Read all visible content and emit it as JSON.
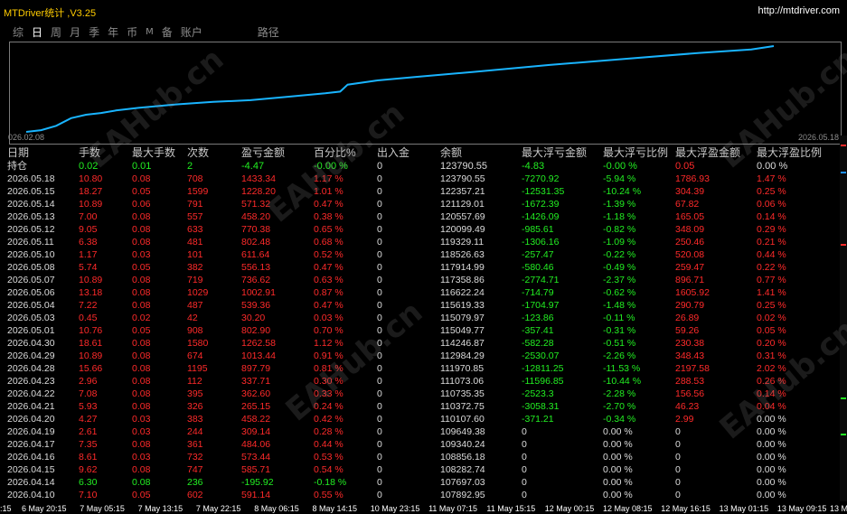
{
  "window": {
    "title": "MTDriver统计 ,V3.25",
    "url": "http://mtdriver.com"
  },
  "tabs": [
    {
      "label": "综",
      "active": false
    },
    {
      "label": "日",
      "active": true
    },
    {
      "label": "周",
      "active": false
    },
    {
      "label": "月",
      "active": false
    },
    {
      "label": "季",
      "active": false
    },
    {
      "label": "年",
      "active": false
    },
    {
      "label": "币",
      "active": false
    },
    {
      "label": "M",
      "active": false
    },
    {
      "label": "备",
      "active": false
    },
    {
      "label": "账户",
      "active": false
    },
    {
      "label": "路径",
      "active": false
    }
  ],
  "equity_chart": {
    "start_label": "026.02.08",
    "end_label": "2026.05.18",
    "line_color": "#19b4ff",
    "points": [
      [
        0,
        0.0
      ],
      [
        0.02,
        0.02
      ],
      [
        0.04,
        0.07
      ],
      [
        0.06,
        0.16
      ],
      [
        0.08,
        0.2
      ],
      [
        0.1,
        0.22
      ],
      [
        0.12,
        0.25
      ],
      [
        0.15,
        0.28
      ],
      [
        0.2,
        0.32
      ],
      [
        0.25,
        0.35
      ],
      [
        0.3,
        0.37
      ],
      [
        0.35,
        0.41
      ],
      [
        0.4,
        0.45
      ],
      [
        0.42,
        0.47
      ],
      [
        0.43,
        0.55
      ],
      [
        0.47,
        0.6
      ],
      [
        0.52,
        0.64
      ],
      [
        0.6,
        0.7
      ],
      [
        0.7,
        0.78
      ],
      [
        0.8,
        0.85
      ],
      [
        0.9,
        0.92
      ],
      [
        0.97,
        0.96
      ],
      [
        1.0,
        1.0
      ]
    ]
  },
  "columns": [
    "日期",
    "手数",
    "最大手数",
    "次数",
    "盈亏金额",
    "百分比%",
    "出入金",
    "余额",
    "最大浮亏金额",
    "最大浮亏比例",
    "最大浮盈金额",
    "最大浮盈比例"
  ],
  "holding": {
    "label": "持仓",
    "lots": "0.02",
    "max_lots": "0.01",
    "count": "2",
    "pnl": "-4.47",
    "pct": "-0.00 %",
    "deposit": "0",
    "balance": "123790.55",
    "max_float_loss": "-4.83",
    "max_float_loss_pct": "-0.00 %",
    "max_float_profit": "0.05",
    "max_float_profit_pct": "0.00 %"
  },
  "rows": [
    {
      "date": "2026.05.18",
      "lots": "10.80",
      "max_lots": "0.08",
      "count": "708",
      "pnl": "1433.34",
      "pct": "1.17 %",
      "deposit": "0",
      "balance": "123790.55",
      "mfl": "-7270.92",
      "mflp": "-5.94 %",
      "mfp": "1786.93",
      "mfpp": "1.47 %",
      "tone": "red"
    },
    {
      "date": "2026.05.15",
      "lots": "18.27",
      "max_lots": "0.05",
      "count": "1599",
      "pnl": "1228.20",
      "pct": "1.01 %",
      "deposit": "0",
      "balance": "122357.21",
      "mfl": "-12531.35",
      "mflp": "-10.24 %",
      "mfp": "304.39",
      "mfpp": "0.25 %",
      "tone": "red"
    },
    {
      "date": "2026.05.14",
      "lots": "10.89",
      "max_lots": "0.06",
      "count": "791",
      "pnl": "571.32",
      "pct": "0.47 %",
      "deposit": "0",
      "balance": "121129.01",
      "mfl": "-1672.39",
      "mflp": "-1.39 %",
      "mfp": "67.82",
      "mfpp": "0.06 %",
      "tone": "red"
    },
    {
      "date": "2026.05.13",
      "lots": "7.00",
      "max_lots": "0.08",
      "count": "557",
      "pnl": "458.20",
      "pct": "0.38 %",
      "deposit": "0",
      "balance": "120557.69",
      "mfl": "-1426.09",
      "mflp": "-1.18 %",
      "mfp": "165.05",
      "mfpp": "0.14 %",
      "tone": "red"
    },
    {
      "date": "2026.05.12",
      "lots": "9.05",
      "max_lots": "0.08",
      "count": "633",
      "pnl": "770.38",
      "pct": "0.65 %",
      "deposit": "0",
      "balance": "120099.49",
      "mfl": "-985.61",
      "mflp": "-0.82 %",
      "mfp": "348.09",
      "mfpp": "0.29 %",
      "tone": "red"
    },
    {
      "date": "2026.05.11",
      "lots": "6.38",
      "max_lots": "0.08",
      "count": "481",
      "pnl": "802.48",
      "pct": "0.68 %",
      "deposit": "0",
      "balance": "119329.11",
      "mfl": "-1306.16",
      "mflp": "-1.09 %",
      "mfp": "250.46",
      "mfpp": "0.21 %",
      "tone": "red"
    },
    {
      "date": "2026.05.10",
      "lots": "1.17",
      "max_lots": "0.03",
      "count": "101",
      "pnl": "611.64",
      "pct": "0.52 %",
      "deposit": "0",
      "balance": "118526.63",
      "mfl": "-257.47",
      "mflp": "-0.22 %",
      "mfp": "520.08",
      "mfpp": "0.44 %",
      "tone": "red"
    },
    {
      "date": "2026.05.08",
      "lots": "5.74",
      "max_lots": "0.05",
      "count": "382",
      "pnl": "556.13",
      "pct": "0.47 %",
      "deposit": "0",
      "balance": "117914.99",
      "mfl": "-580.46",
      "mflp": "-0.49 %",
      "mfp": "259.47",
      "mfpp": "0.22 %",
      "tone": "red"
    },
    {
      "date": "2026.05.07",
      "lots": "10.89",
      "max_lots": "0.08",
      "count": "719",
      "pnl": "736.62",
      "pct": "0.63 %",
      "deposit": "0",
      "balance": "117358.86",
      "mfl": "-2774.71",
      "mflp": "-2.37 %",
      "mfp": "896.71",
      "mfpp": "0.77 %",
      "tone": "red"
    },
    {
      "date": "2026.05.06",
      "lots": "13.18",
      "max_lots": "0.08",
      "count": "1029",
      "pnl": "1002.91",
      "pct": "0.87 %",
      "deposit": "0",
      "balance": "116622.24",
      "mfl": "-714.79",
      "mflp": "-0.62 %",
      "mfp": "1605.92",
      "mfpp": "1.41 %",
      "tone": "red"
    },
    {
      "date": "2026.05.04",
      "lots": "7.22",
      "max_lots": "0.08",
      "count": "487",
      "pnl": "539.36",
      "pct": "0.47 %",
      "deposit": "0",
      "balance": "115619.33",
      "mfl": "-1704.97",
      "mflp": "-1.48 %",
      "mfp": "290.79",
      "mfpp": "0.25 %",
      "tone": "red"
    },
    {
      "date": "2026.05.03",
      "lots": "0.45",
      "max_lots": "0.02",
      "count": "42",
      "pnl": "30.20",
      "pct": "0.03 %",
      "deposit": "0",
      "balance": "115079.97",
      "mfl": "-123.86",
      "mflp": "-0.11 %",
      "mfp": "26.89",
      "mfpp": "0.02 %",
      "tone": "red"
    },
    {
      "date": "2026.05.01",
      "lots": "10.76",
      "max_lots": "0.05",
      "count": "908",
      "pnl": "802.90",
      "pct": "0.70 %",
      "deposit": "0",
      "balance": "115049.77",
      "mfl": "-357.41",
      "mflp": "-0.31 %",
      "mfp": "59.26",
      "mfpp": "0.05 %",
      "tone": "red"
    },
    {
      "date": "2026.04.30",
      "lots": "18.61",
      "max_lots": "0.08",
      "count": "1580",
      "pnl": "1262.58",
      "pct": "1.12 %",
      "deposit": "0",
      "balance": "114246.87",
      "mfl": "-582.28",
      "mflp": "-0.51 %",
      "mfp": "230.38",
      "mfpp": "0.20 %",
      "tone": "red"
    },
    {
      "date": "2026.04.29",
      "lots": "10.89",
      "max_lots": "0.08",
      "count": "674",
      "pnl": "1013.44",
      "pct": "0.91 %",
      "deposit": "0",
      "balance": "112984.29",
      "mfl": "-2530.07",
      "mflp": "-2.26 %",
      "mfp": "348.43",
      "mfpp": "0.31 %",
      "tone": "red"
    },
    {
      "date": "2026.04.28",
      "lots": "15.66",
      "max_lots": "0.08",
      "count": "1195",
      "pnl": "897.79",
      "pct": "0.81 %",
      "deposit": "0",
      "balance": "111970.85",
      "mfl": "-12811.25",
      "mflp": "-11.53 %",
      "mfp": "2197.58",
      "mfpp": "2.02 %",
      "tone": "red"
    },
    {
      "date": "2026.04.23",
      "lots": "2.96",
      "max_lots": "0.08",
      "count": "112",
      "pnl": "337.71",
      "pct": "0.30 %",
      "deposit": "0",
      "balance": "111073.06",
      "mfl": "-11596.85",
      "mflp": "-10.44 %",
      "mfp": "288.53",
      "mfpp": "0.26 %",
      "tone": "red"
    },
    {
      "date": "2026.04.22",
      "lots": "7.08",
      "max_lots": "0.08",
      "count": "395",
      "pnl": "362.60",
      "pct": "0.33 %",
      "deposit": "0",
      "balance": "110735.35",
      "mfl": "-2523.3",
      "mflp": "-2.28 %",
      "mfp": "156.56",
      "mfpp": "0.14 %",
      "tone": "red"
    },
    {
      "date": "2026.04.21",
      "lots": "5.93",
      "max_lots": "0.08",
      "count": "326",
      "pnl": "265.15",
      "pct": "0.24 %",
      "deposit": "0",
      "balance": "110372.75",
      "mfl": "-3058.31",
      "mflp": "-2.70 %",
      "mfp": "46.23",
      "mfpp": "0.04 %",
      "tone": "red"
    },
    {
      "date": "2026.04.20",
      "lots": "4.27",
      "max_lots": "0.03",
      "count": "383",
      "pnl": "458.22",
      "pct": "0.42 %",
      "deposit": "0",
      "balance": "110107.60",
      "mfl": "-371.21",
      "mflp": "-0.34 %",
      "mfp": "2.99",
      "mfpp": "0.00 %",
      "tone": "red"
    },
    {
      "date": "2026.04.19",
      "lots": "2.61",
      "max_lots": "0.03",
      "count": "244",
      "pnl": "309.14",
      "pct": "0.28 %",
      "deposit": "0",
      "balance": "109649.38",
      "mfl": "0",
      "mflp": "0.00 %",
      "mfp": "0",
      "mfpp": "0.00 %",
      "tone": "red"
    },
    {
      "date": "2026.04.17",
      "lots": "7.35",
      "max_lots": "0.08",
      "count": "361",
      "pnl": "484.06",
      "pct": "0.44 %",
      "deposit": "0",
      "balance": "109340.24",
      "mfl": "0",
      "mflp": "0.00 %",
      "mfp": "0",
      "mfpp": "0.00 %",
      "tone": "red"
    },
    {
      "date": "2026.04.16",
      "lots": "8.61",
      "max_lots": "0.03",
      "count": "732",
      "pnl": "573.44",
      "pct": "0.53 %",
      "deposit": "0",
      "balance": "108856.18",
      "mfl": "0",
      "mflp": "0.00 %",
      "mfp": "0",
      "mfpp": "0.00 %",
      "tone": "red"
    },
    {
      "date": "2026.04.15",
      "lots": "9.62",
      "max_lots": "0.08",
      "count": "747",
      "pnl": "585.71",
      "pct": "0.54 %",
      "deposit": "0",
      "balance": "108282.74",
      "mfl": "0",
      "mflp": "0.00 %",
      "mfp": "0",
      "mfpp": "0.00 %",
      "tone": "red"
    },
    {
      "date": "2026.04.14",
      "lots": "6.30",
      "max_lots": "0.08",
      "count": "236",
      "pnl": "-195.92",
      "pct": "-0.18 %",
      "deposit": "0",
      "balance": "107697.03",
      "mfl": "0",
      "mflp": "0.00 %",
      "mfp": "0",
      "mfpp": "0.00 %",
      "tone": "green"
    },
    {
      "date": "2026.04.10",
      "lots": "7.10",
      "max_lots": "0.05",
      "count": "602",
      "pnl": "591.14",
      "pct": "0.55 %",
      "deposit": "0",
      "balance": "107892.95",
      "mfl": "0",
      "mflp": "0.00 %",
      "mfp": "0",
      "mfpp": "0.00 %",
      "tone": "red"
    }
  ],
  "time_axis": [
    "6 May 20:15",
    "7 May 05:15",
    "7 May 13:15",
    "7 May 22:15",
    "8 May 06:15",
    "8 May 14:15",
    "10 May 23:15",
    "11 May 07:15",
    "11 May 15:15",
    "12 May 00:15",
    "12 May 08:15",
    "12 May 16:15",
    "13 May 01:15",
    "13 May 09:15"
  ],
  "time_axis_lead": ":15",
  "time_axis_tail": "13 M",
  "watermark": "EAHub.cn"
}
